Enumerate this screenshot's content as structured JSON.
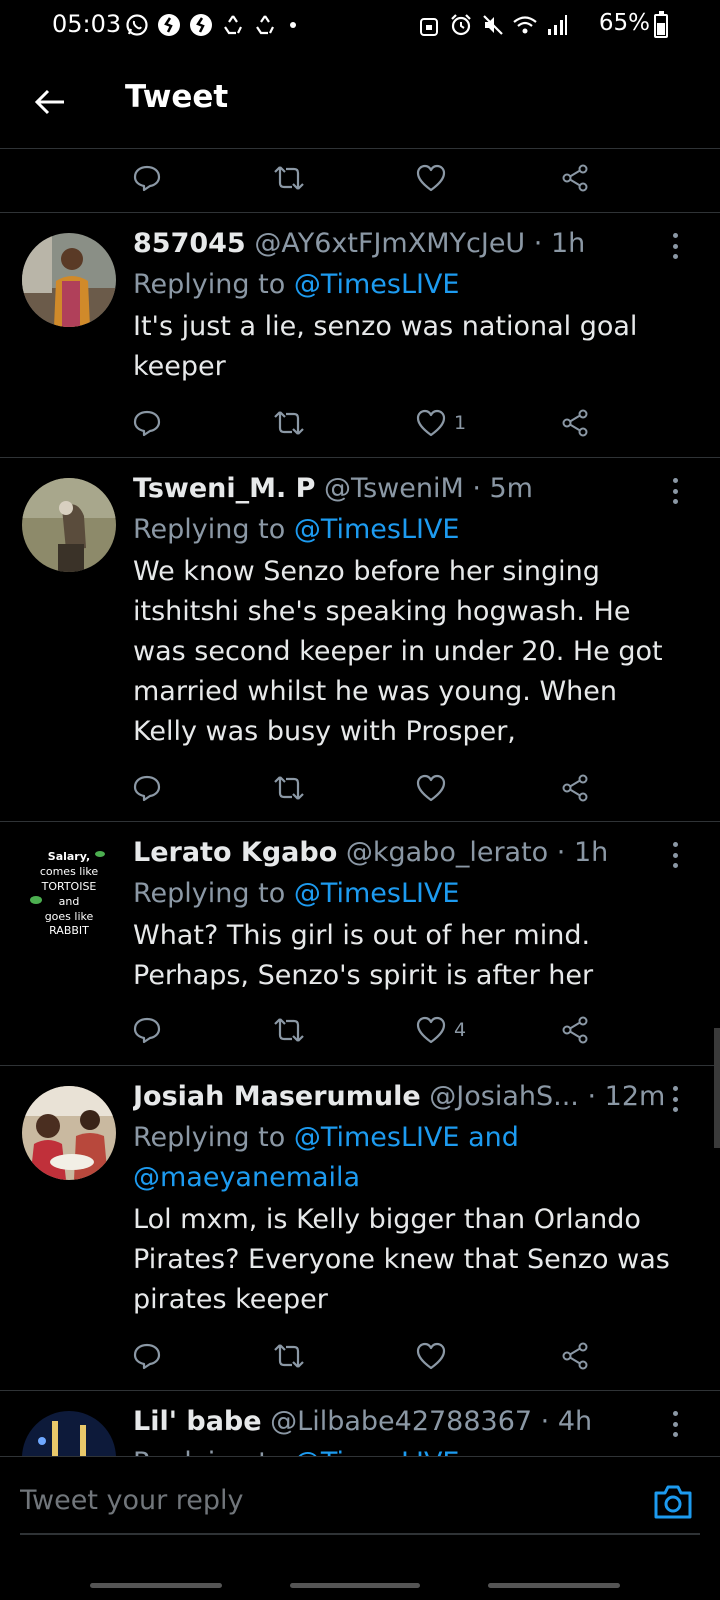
{
  "status_bar": {
    "time": "05:03",
    "battery": "65%",
    "left_icons": [
      "whatsapp-icon",
      "shazam-icon",
      "shazam-icon",
      "recycle-icon",
      "recycle-icon"
    ],
    "right_icons": [
      "alarm-lock-icon",
      "alarm-icon",
      "mute-icon",
      "wifi-icon",
      "signal-icon"
    ]
  },
  "header": {
    "title": "Tweet"
  },
  "tweets": [
    {
      "name": "857045",
      "handle": "@AY6xtFJmXMYcJeU",
      "time": "1h",
      "replying_prefix": "Replying to ",
      "replying_to": "@TimesLIVE",
      "text": "It's just a lie, senzo was national goal keeper",
      "likes": "1"
    },
    {
      "name": "Tsweni_M. P",
      "handle": "@TsweniM",
      "time": "5m",
      "replying_prefix": "Replying to ",
      "replying_to": "@TimesLIVE",
      "text": "We know Senzo before her singing itshitshi she's speaking hogwash. He was second keeper in under 20. He got married whilst he was young. When Kelly was busy with Prosper,",
      "likes": ""
    },
    {
      "name": "Lerato Kgabo",
      "handle": "@kgabo_lerato",
      "time": "1h",
      "replying_prefix": "Replying to ",
      "replying_to": "@TimesLIVE",
      "text": "What? This girl is out of her mind. Perhaps, Senzo's spirit is after her",
      "likes": "4",
      "avatar_text": [
        "Salary,",
        "comes like",
        "TORTOISE",
        "and",
        "goes like",
        "RABBIT"
      ]
    },
    {
      "name": "Josiah Maserumule",
      "handle": "@JosiahS...",
      "time": "12m",
      "replying_prefix": "Replying to ",
      "replying_to": "@TimesLIVE and @maeyanemaila",
      "text": "Lol mxm, is Kelly bigger than Orlando Pirates?  Everyone knew that Senzo was pirates keeper",
      "likes": ""
    },
    {
      "name": "Lil' babe",
      "handle": "@Lilbabe42788367",
      "time": "4h",
      "replying_prefix": "Replying to ",
      "replying_to": "@TimesLIVE",
      "text": "",
      "likes": ""
    }
  ],
  "separator": " · ",
  "reply_bar": {
    "placeholder": "Tweet your reply"
  },
  "colors": {
    "background": "#000000",
    "accent": "#1d9bf0",
    "muted": "#8b98a5",
    "divider": "#2f3336"
  }
}
